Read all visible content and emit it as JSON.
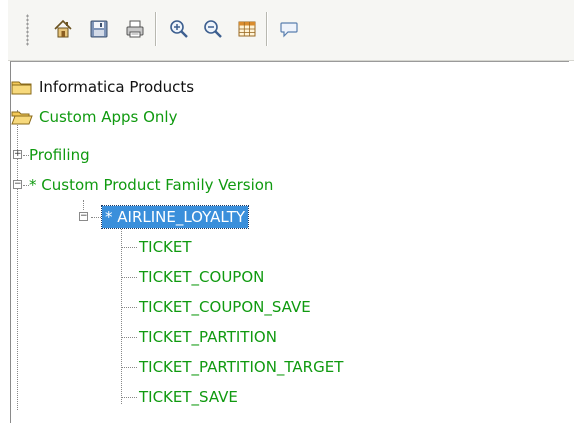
{
  "toolbar": {
    "buttons": [
      {
        "name": "home-button",
        "icon": "home-icon"
      },
      {
        "name": "save-button",
        "icon": "floppy-disk-icon"
      },
      {
        "name": "print-button",
        "icon": "printer-icon"
      },
      {
        "name": "zoom-in-button",
        "icon": "zoom-in-icon"
      },
      {
        "name": "zoom-out-button",
        "icon": "zoom-out-icon"
      },
      {
        "name": "table-button",
        "icon": "table-icon"
      },
      {
        "name": "comment-button",
        "icon": "speech-bubble-icon"
      }
    ]
  },
  "tree": {
    "root1": {
      "label": "Informatica Products",
      "icon": "folder-closed-icon"
    },
    "root2": {
      "label": "Custom Apps Only",
      "icon": "folder-open-icon"
    },
    "profiling": {
      "label": "Profiling",
      "expander": "+"
    },
    "family": {
      "label": "* Custom Product Family Version",
      "expander": "−"
    },
    "airline": {
      "label": "* AIRLINE_LOYALTY",
      "expander": "−",
      "selected": true
    },
    "children": [
      {
        "label": "TICKET"
      },
      {
        "label": "TICKET_COUPON"
      },
      {
        "label": "TICKET_COUPON_SAVE"
      },
      {
        "label": "TICKET_PARTITION"
      },
      {
        "label": "TICKET_PARTITION_TARGET"
      },
      {
        "label": "TICKET_SAVE"
      }
    ]
  },
  "colors": {
    "green_text": "#109a10",
    "selection": "#3a8fdb",
    "folder": "#f3c95a"
  }
}
